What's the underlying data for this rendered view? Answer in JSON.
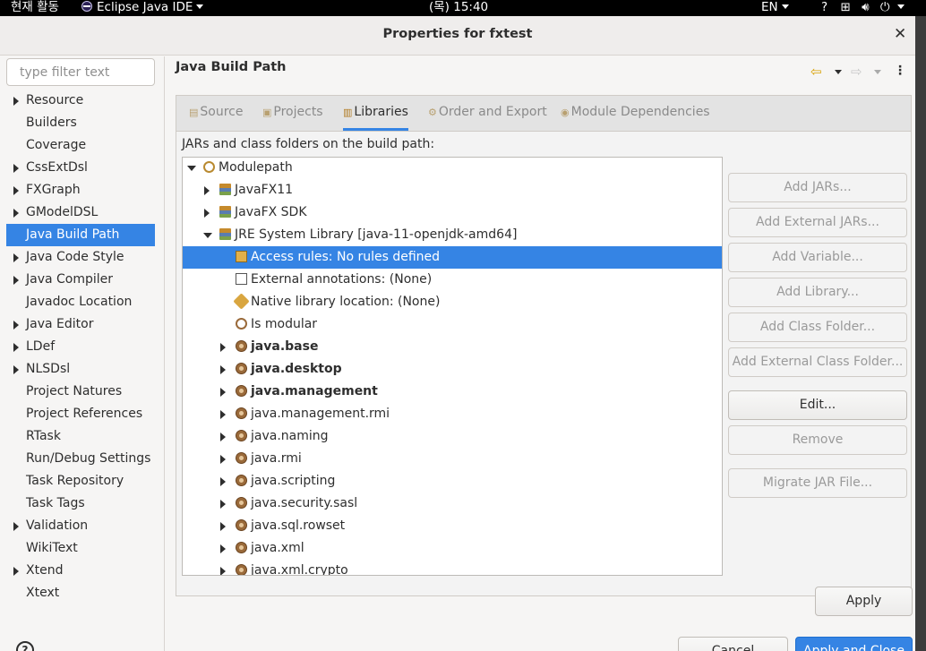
{
  "topbar": {
    "activities": "현재 활동",
    "app_menu": "Eclipse Java IDE",
    "clock": "(목) 15:40",
    "lang": "EN",
    "access_symbol": "?"
  },
  "dialog": {
    "title": "Properties for fxtest",
    "close_glyph": "✕"
  },
  "filter": {
    "placeholder": "type filter text"
  },
  "nav": {
    "items": [
      {
        "label": "Resource",
        "expandable": true
      },
      {
        "label": "Builders",
        "expandable": false
      },
      {
        "label": "Coverage",
        "expandable": false
      },
      {
        "label": "CssExtDsl",
        "expandable": true
      },
      {
        "label": "FXGraph",
        "expandable": true
      },
      {
        "label": "GModelDSL",
        "expandable": true
      },
      {
        "label": "Java Build Path",
        "expandable": false,
        "selected": true
      },
      {
        "label": "Java Code Style",
        "expandable": true
      },
      {
        "label": "Java Compiler",
        "expandable": true
      },
      {
        "label": "Javadoc Location",
        "expandable": false
      },
      {
        "label": "Java Editor",
        "expandable": true
      },
      {
        "label": "LDef",
        "expandable": true
      },
      {
        "label": "NLSDsl",
        "expandable": true
      },
      {
        "label": "Project Natures",
        "expandable": false
      },
      {
        "label": "Project References",
        "expandable": false
      },
      {
        "label": "RTask",
        "expandable": false
      },
      {
        "label": "Run/Debug Settings",
        "expandable": false
      },
      {
        "label": "Task Repository",
        "expandable": false
      },
      {
        "label": "Task Tags",
        "expandable": false
      },
      {
        "label": "Validation",
        "expandable": true
      },
      {
        "label": "WikiText",
        "expandable": false
      },
      {
        "label": "Xtend",
        "expandable": true
      },
      {
        "label": "Xtext",
        "expandable": false
      }
    ]
  },
  "page": {
    "title": "Java Build Path",
    "description": "JARs and class folders on the build path:"
  },
  "tabs": [
    {
      "label": "Source",
      "active": false
    },
    {
      "label": "Projects",
      "active": false
    },
    {
      "label": "Libraries",
      "active": true
    },
    {
      "label": "Order and Export",
      "active": false
    },
    {
      "label": "Module Dependencies",
      "active": false
    }
  ],
  "tree": {
    "rows": [
      {
        "label": "Modulepath",
        "twisty": "open",
        "icon": "modulepath-icon"
      },
      {
        "label": "JavaFX11",
        "twisty": "closed",
        "icon": "library-icon"
      },
      {
        "label": "JavaFX SDK",
        "twisty": "closed",
        "icon": "library-icon"
      },
      {
        "label": "JRE System Library [java-11-openjdk-amd64]",
        "twisty": "open",
        "icon": "library-icon"
      },
      {
        "label": "Access rules: No rules defined",
        "twisty": "none",
        "icon": "access-rules-icon",
        "selected": true
      },
      {
        "label": "External annotations: (None)",
        "twisty": "none",
        "icon": "external-annotations-icon"
      },
      {
        "label": "Native library location: (None)",
        "twisty": "none",
        "icon": "native-library-icon"
      },
      {
        "label": "Is modular",
        "twisty": "none",
        "icon": "is-modular-icon"
      },
      {
        "label": "java.base",
        "twisty": "closed",
        "icon": "module-icon",
        "bold": true
      },
      {
        "label": "java.desktop",
        "twisty": "closed",
        "icon": "module-icon",
        "bold": true
      },
      {
        "label": "java.management",
        "twisty": "closed",
        "icon": "module-icon",
        "bold": true
      },
      {
        "label": "java.management.rmi",
        "twisty": "closed",
        "icon": "module-icon"
      },
      {
        "label": "java.naming",
        "twisty": "closed",
        "icon": "module-icon"
      },
      {
        "label": "java.rmi",
        "twisty": "closed",
        "icon": "module-icon"
      },
      {
        "label": "java.scripting",
        "twisty": "closed",
        "icon": "module-icon"
      },
      {
        "label": "java.security.sasl",
        "twisty": "closed",
        "icon": "module-icon"
      },
      {
        "label": "java.sql.rowset",
        "twisty": "closed",
        "icon": "module-icon"
      },
      {
        "label": "java.xml",
        "twisty": "closed",
        "icon": "module-icon"
      },
      {
        "label": "java.xml.crypto",
        "twisty": "closed",
        "icon": "module-icon"
      }
    ]
  },
  "buttons": [
    {
      "label": "Add JARs...",
      "enabled": false
    },
    {
      "label": "Add External JARs...",
      "enabled": false
    },
    {
      "label": "Add Variable...",
      "enabled": false
    },
    {
      "label": "Add Library...",
      "enabled": false
    },
    {
      "label": "Add Class Folder...",
      "enabled": false
    },
    {
      "label": "Add External Class Folder...",
      "enabled": false
    },
    {
      "label": "Edit...",
      "enabled": true
    },
    {
      "label": "Remove",
      "enabled": false
    },
    {
      "label": "Migrate JAR File...",
      "enabled": false
    }
  ],
  "footer": {
    "apply": "Apply",
    "cancel": "Cancel",
    "apply_close": "Apply and Close",
    "help_glyph": "?"
  },
  "colors": {
    "selection": "#3584e4",
    "topbar": "#000000",
    "dialog_bg": "#f6f5f4"
  }
}
